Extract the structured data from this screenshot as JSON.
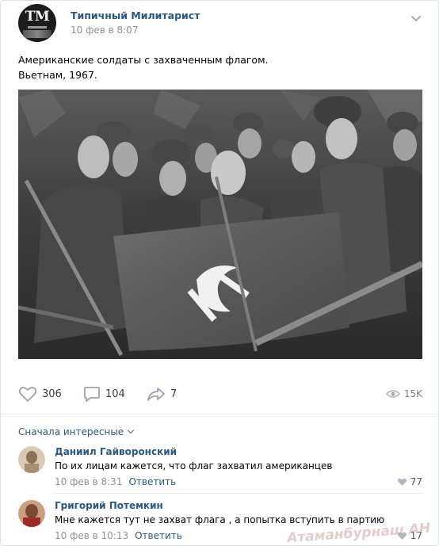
{
  "post": {
    "author": "Типичный Милитарист",
    "time": "10 фев в 8:07",
    "text_line1": "Американские солдаты с захваченным флагом.",
    "text_line2": "Вьетнам, 1967.",
    "avatar_icon": "tm-logo-icon"
  },
  "actions": {
    "likes": "306",
    "comments": "104",
    "shares": "7",
    "views": "15K"
  },
  "comments_section": {
    "sort_label": "Сначала интересные"
  },
  "comments": [
    {
      "name": "Даниил Гайворонский",
      "text": "По их лицам кажется, что флаг захватил американцев",
      "time": "10 фев в 8:31",
      "reply": "Ответить",
      "likes": "77"
    },
    {
      "name": "Григорий Потемкин",
      "text": "Мне кажется тут не захват флага , а попытка вступить в партию",
      "time": "10 фев в 10:13",
      "reply": "Ответить",
      "likes": "17"
    }
  ],
  "watermark": "Атаманбурнаш АН"
}
